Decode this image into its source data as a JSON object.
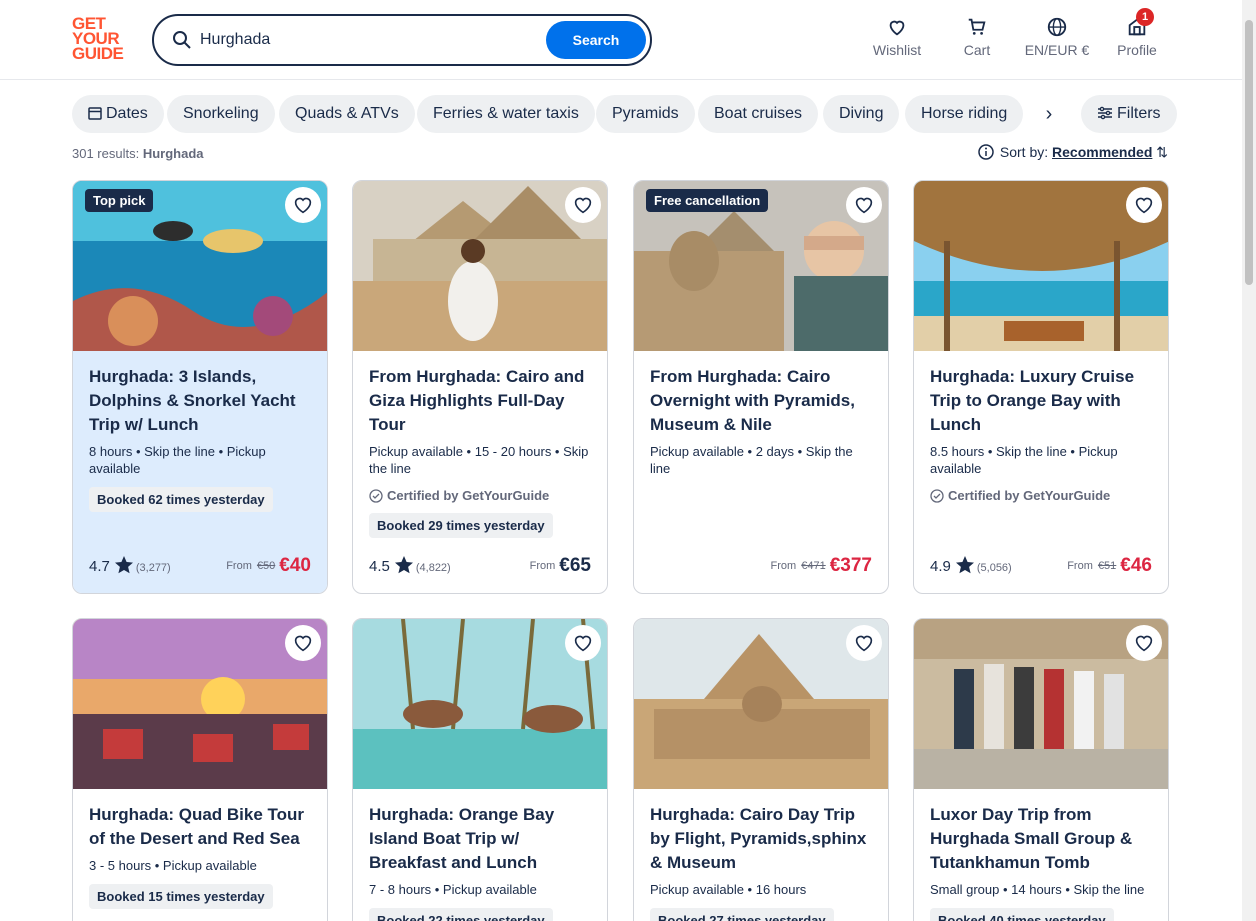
{
  "logo": [
    "GET",
    "YOUR",
    "GUIDE"
  ],
  "search": {
    "value": "Hurghada",
    "button": "Search"
  },
  "nav": {
    "wishlist": "Wishlist",
    "cart": "Cart",
    "lang": "EN/EUR €",
    "profile": "Profile",
    "profile_badge": "1"
  },
  "chips": [
    "Dates",
    "Snorkeling",
    "Quads & ATVs",
    "Ferries & water taxis",
    "Pyramids",
    "Boat cruises",
    "Diving",
    "Horse riding"
  ],
  "filters_label": "Filters",
  "results": {
    "count": "301 results:",
    "query": "Hurghada"
  },
  "sort": {
    "label": "Sort by:",
    "value": "Recommended"
  },
  "from_label": "From",
  "cards": [
    {
      "tag": "Top pick",
      "title": "Hurghada: 3 Islands, Dolphins & Snorkel Yacht Trip w/ Lunch",
      "meta": "8 hours • Skip the line • Pickup available",
      "booked": "Booked 62 times yesterday",
      "rating": "4.7",
      "reviews": "(3,277)",
      "old_price": "€50",
      "price": "€40"
    },
    {
      "title": "From Hurghada: Cairo and Giza Highlights Full-Day Tour",
      "meta": "Pickup available • 15 - 20 hours • Skip the line",
      "cert": "Certified by GetYourGuide",
      "booked": "Booked 29 times yesterday",
      "rating": "4.5",
      "reviews": "(4,822)",
      "price": "€65"
    },
    {
      "tag": "Free cancellation",
      "title": "From Hurghada: Cairo Overnight with Pyramids, Museum & Nile",
      "meta": "Pickup available • 2 days • Skip the line",
      "old_price": "€471",
      "price": "€377"
    },
    {
      "title": "Hurghada: Luxury Cruise Trip to Orange Bay with Lunch",
      "meta": "8.5 hours • Skip the line • Pickup available",
      "cert": "Certified by GetYourGuide",
      "rating": "4.9",
      "reviews": "(5,056)",
      "old_price": "€51",
      "price": "€46"
    },
    {
      "title": "Hurghada: Quad Bike Tour of the Desert and Red Sea",
      "meta": "3 - 5 hours • Pickup available",
      "booked": "Booked 15 times yesterday"
    },
    {
      "title": "Hurghada: Orange Bay Island Boat Trip w/ Breakfast and Lunch",
      "meta": "7 - 8 hours • Pickup available",
      "booked": "Booked 22 times yesterday"
    },
    {
      "title": "Hurghada: Cairo Day Trip by Flight, Pyramids,sphinx & Museum",
      "meta": "Pickup available • 16 hours",
      "booked": "Booked 27 times yesterday"
    },
    {
      "title": "Luxor Day Trip from Hurghada Small Group & Tutankhamun Tomb",
      "meta": "Small group • 14 hours • Skip the line",
      "booked": "Booked 40 times yesterday"
    }
  ],
  "colors": {
    "accent": "#0071eb",
    "brand": "#ff5533",
    "sale": "#dc2642",
    "highlight": "#ddecfd"
  }
}
